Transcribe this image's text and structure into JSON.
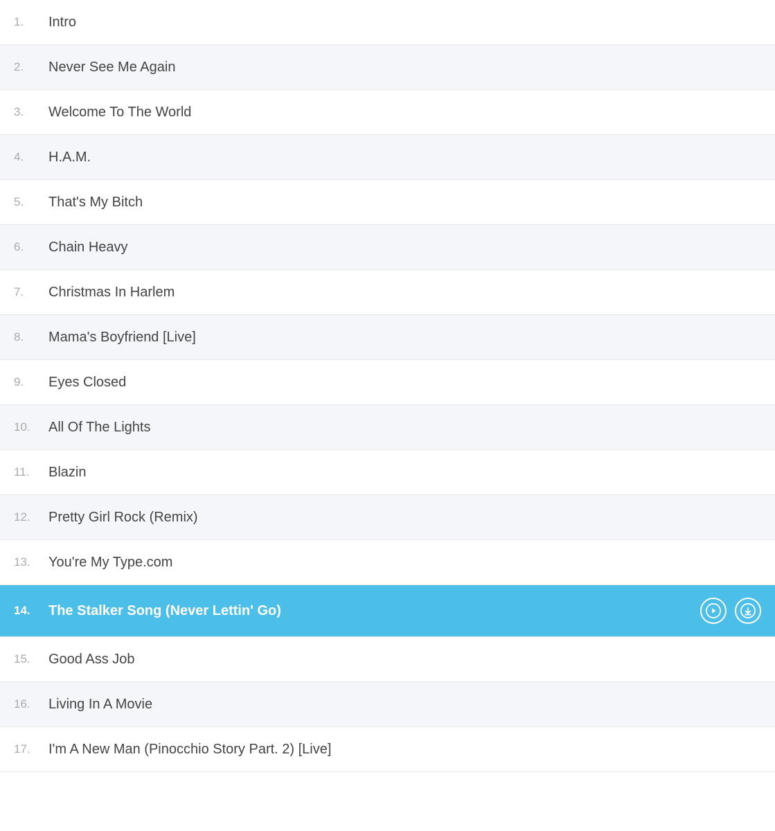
{
  "tracks": [
    {
      "number": "1.",
      "title": "Intro",
      "active": false
    },
    {
      "number": "2.",
      "title": "Never See Me Again",
      "active": false
    },
    {
      "number": "3.",
      "title": "Welcome To The World",
      "active": false
    },
    {
      "number": "4.",
      "title": "H.A.M.",
      "active": false
    },
    {
      "number": "5.",
      "title": "That's My Bitch",
      "active": false
    },
    {
      "number": "6.",
      "title": "Chain Heavy",
      "active": false
    },
    {
      "number": "7.",
      "title": "Christmas In Harlem",
      "active": false
    },
    {
      "number": "8.",
      "title": "Mama's Boyfriend [Live]",
      "active": false
    },
    {
      "number": "9.",
      "title": "Eyes Closed",
      "active": false
    },
    {
      "number": "10.",
      "title": "All Of The Lights",
      "active": false
    },
    {
      "number": "11.",
      "title": "Blazin",
      "active": false
    },
    {
      "number": "12.",
      "title": "Pretty Girl Rock (Remix)",
      "active": false
    },
    {
      "number": "13.",
      "title": "You're My Type.com",
      "active": false
    },
    {
      "number": "14.",
      "title": "The Stalker Song (Never Lettin' Go)",
      "active": true
    },
    {
      "number": "15.",
      "title": "Good Ass Job",
      "active": false
    },
    {
      "number": "16.",
      "title": "Living In A Movie",
      "active": false
    },
    {
      "number": "17.",
      "title": "I'm A New Man (Pinocchio Story Part. 2) [Live]",
      "active": false
    }
  ],
  "icons": {
    "play": "play-icon",
    "download": "download-icon"
  }
}
